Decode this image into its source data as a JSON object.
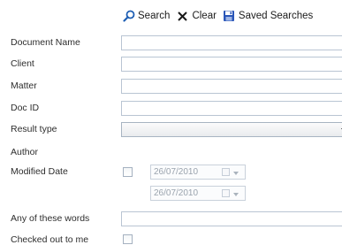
{
  "toolbar": {
    "search_label": "Search",
    "clear_label": "Clear",
    "saved_searches_label": "Saved Searches"
  },
  "form": {
    "document_name_label": "Document Name",
    "document_name_value": "",
    "client_label": "Client",
    "client_value": "",
    "matter_label": "Matter",
    "matter_value": "",
    "doc_id_label": "Doc ID",
    "doc_id_value": "",
    "result_type_label": "Result type",
    "result_type_value": "",
    "author_label": "Author",
    "modified_date_label": "Modified Date",
    "modified_date_enabled": false,
    "modified_date_from": "26/07/2010",
    "modified_date_to": "26/07/2010",
    "any_words_label": "Any of these words",
    "any_words_value": "",
    "checked_out_label": "Checked out to me",
    "checked_out_value": false
  },
  "colors": {
    "field_border": "#b9c5d3",
    "search_icon": "#1f5fb4",
    "clear_icon": "#1a1a1a",
    "save_icon": "#2a56b8"
  },
  "icons": [
    "search-icon",
    "clear-icon",
    "saved-searches-icon",
    "dropdown-arrow-icon",
    "calendar-dropdown-icon"
  ]
}
